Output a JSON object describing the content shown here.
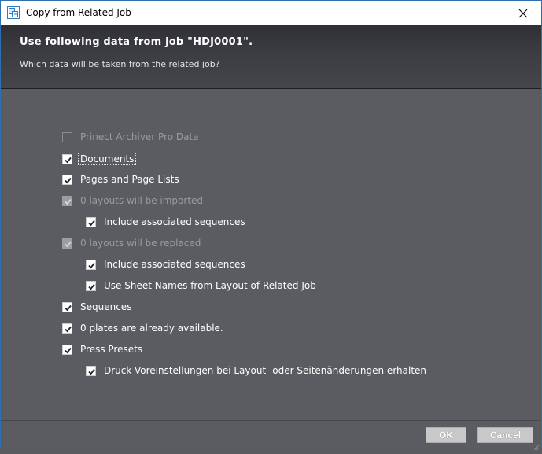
{
  "window": {
    "title": "Copy from Related Job"
  },
  "header": {
    "title": "Use following data from job \"HDJ0001\".",
    "subtitle": "Which data will be taken from the related job?"
  },
  "options": [
    {
      "label": "Prinect Archiver Pro Data",
      "checked": false,
      "enabled": false
    },
    {
      "label": "Documents",
      "checked": true,
      "enabled": true
    },
    {
      "label": "Pages and Page Lists",
      "checked": true,
      "enabled": true
    },
    {
      "label": "0 layouts will be imported",
      "checked": true,
      "enabled": false
    },
    {
      "label": "Include associated sequences",
      "checked": true,
      "enabled": true
    },
    {
      "label": "0 layouts will be replaced",
      "checked": true,
      "enabled": false
    },
    {
      "label": "Include associated sequences",
      "checked": true,
      "enabled": true
    },
    {
      "label": "Use Sheet Names from Layout of Related Job",
      "checked": true,
      "enabled": true
    },
    {
      "label": "Sequences",
      "checked": true,
      "enabled": true
    },
    {
      "label": "0 plates are already available.",
      "checked": true,
      "enabled": true
    },
    {
      "label": "Press Presets",
      "checked": true,
      "enabled": true
    },
    {
      "label": "Druck-Voreinstellungen bei Layout- oder Seitenänderungen erhalten",
      "checked": true,
      "enabled": true
    }
  ],
  "buttons": {
    "ok": "OK",
    "cancel": "Cancel"
  },
  "icons": {
    "app": "copy-job-icon",
    "close": "close-icon"
  }
}
